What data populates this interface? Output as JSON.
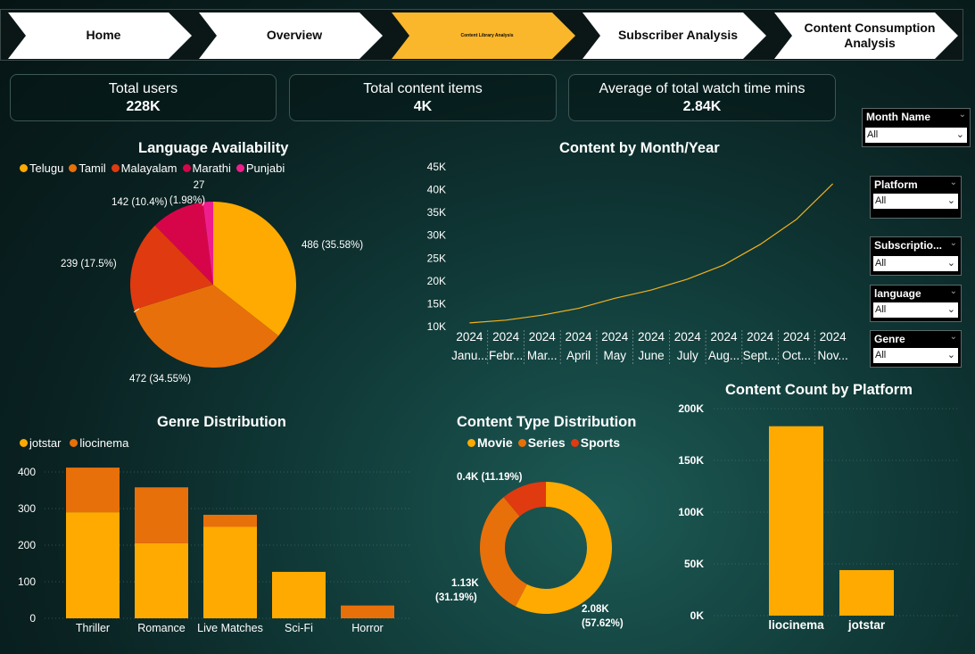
{
  "nav": {
    "tabs": [
      {
        "label": "Home"
      },
      {
        "label": "Overview"
      },
      {
        "label": "Content Library Analysis"
      },
      {
        "label": "Subscriber Analysis"
      },
      {
        "label": "Content Consumption Analysis"
      }
    ],
    "active_index": 2
  },
  "kpis": [
    {
      "title": "Total users",
      "value": "228K"
    },
    {
      "title": "Total content items",
      "value": "4K"
    },
    {
      "title": "Average of total watch time mins",
      "value": "2.84K"
    }
  ],
  "slicers": [
    {
      "label": "Month Name",
      "value": "All"
    },
    {
      "label": "Platform",
      "value": "All"
    },
    {
      "label": "Subscriptio...",
      "value": "All"
    },
    {
      "label": "language",
      "value": "All"
    },
    {
      "label": "Genre",
      "value": "All"
    }
  ],
  "colors": {
    "orange_light": "#FFAA00",
    "orange_dark": "#E8700A",
    "red": "#E03A10",
    "crimson": "#D6054A",
    "pink": "#F01E8C",
    "line": "#F2B21C"
  },
  "chart_data": [
    {
      "type": "pie",
      "title": "Language Availability",
      "categories": [
        "Telugu",
        "Tamil",
        "Malayalam",
        "Marathi",
        "Punjabi"
      ],
      "values": [
        486,
        472,
        239,
        142,
        27
      ],
      "data_labels": [
        "486 (35.58%)",
        "472 (34.55%)",
        "239 (17.5%)",
        "142 (10.4%)",
        "27 (1.98%)"
      ],
      "legend": "top-left"
    },
    {
      "type": "line",
      "title": "Content by Month/Year",
      "x": [
        "January 2024",
        "February 2024",
        "March 2024",
        "April 2024",
        "May 2024",
        "June 2024",
        "July 2024",
        "August 2024",
        "September 2024",
        "October 2024",
        "November 2024"
      ],
      "x_year_labels": [
        "2024",
        "2024",
        "2024",
        "2024",
        "2024",
        "2024",
        "2024",
        "2024",
        "2024",
        "2024",
        "2024"
      ],
      "x_month_labels": [
        "Janu...",
        "Febr...",
        "Mar...",
        "April",
        "May",
        "June",
        "July",
        "Aug...",
        "Sept...",
        "Oct...",
        "Nov..."
      ],
      "series": [
        {
          "values": [
            10800,
            11400,
            12500,
            14000,
            16200,
            18000,
            20400,
            23500,
            28000,
            33500,
            41300
          ]
        }
      ],
      "ylim": [
        10000,
        45000
      ],
      "yticks": [
        "10K",
        "15K",
        "20K",
        "25K",
        "30K",
        "35K",
        "40K",
        "45K"
      ],
      "grid": false
    },
    {
      "type": "bar",
      "stacked": true,
      "title": "Genre Distribution",
      "categories": [
        "Thriller",
        "Romance",
        "Live Matches",
        "Sci-Fi",
        "Horror"
      ],
      "series": [
        {
          "name": "jotstar",
          "values": [
            290,
            205,
            250,
            127,
            0
          ]
        },
        {
          "name": "liocinema",
          "values": [
            122,
            153,
            33,
            0,
            35
          ]
        }
      ],
      "ylim": [
        0,
        420
      ],
      "yticks": [
        "0",
        "100",
        "200",
        "300",
        "400"
      ],
      "legend": "top-left"
    },
    {
      "type": "pie",
      "donut": true,
      "title": "Content Type Distribution",
      "categories": [
        "Movie",
        "Series",
        "Sports"
      ],
      "values": [
        2080,
        1130,
        400
      ],
      "data_labels": [
        "2.08K (57.62%)",
        "1.13K (31.19%)",
        "0.4K (11.19%)"
      ],
      "legend": "top"
    },
    {
      "type": "bar",
      "title": "Content Count by Platform",
      "categories": [
        "liocinema",
        "jotstar"
      ],
      "values": [
        183000,
        44000
      ],
      "ylim": [
        0,
        200000
      ],
      "yticks": [
        "0K",
        "50K",
        "100K",
        "150K",
        "200K"
      ],
      "grid": true
    }
  ]
}
